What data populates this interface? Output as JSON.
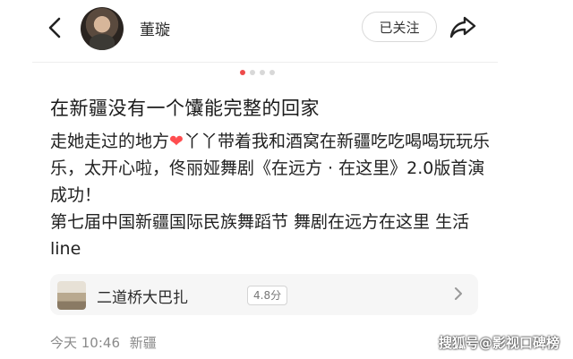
{
  "header": {
    "back_icon": "chevron-left-icon",
    "username": "董璇",
    "follow_label": "已关注",
    "share_icon": "share-arrow-icon"
  },
  "carousel": {
    "dot_count": 4,
    "active_index": 0,
    "active_color": "#ee4b4b"
  },
  "post": {
    "title": "在新疆没有一个馕能完整的回家",
    "body_line1_before_heart": "走她走过的地方",
    "body_line1_after_heart": "丫丫带着我和酒窝在新疆吃吃喝喝玩玩乐乐，太开心啦，佟丽娅舞剧《在远方 · 在这里》2.0版首演成功！",
    "body_line2": "第七届中国新疆国际民族舞蹈节 舞剧在远方在这里 生活line",
    "heart_icon": "heart-icon"
  },
  "location": {
    "name": "二道桥大巴扎",
    "rating": "4.8分",
    "arrow_icon": "chevron-right-icon"
  },
  "meta": {
    "time": "今天 10:46",
    "place": "新疆"
  },
  "watermark": "搜狐号@影视口碑榜"
}
